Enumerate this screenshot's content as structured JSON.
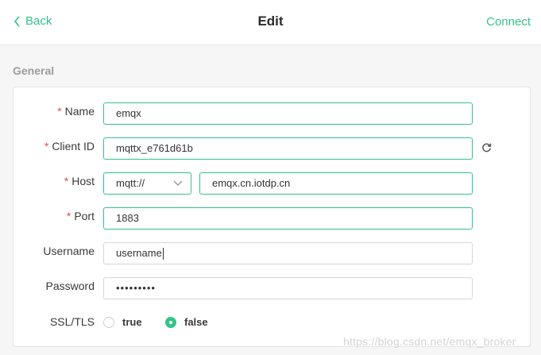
{
  "header": {
    "back_label": "Back",
    "title": "Edit",
    "connect_label": "Connect"
  },
  "section": {
    "title": "General"
  },
  "form": {
    "name": {
      "label": "Name",
      "required": "*",
      "value": "emqx"
    },
    "client_id": {
      "label": "Client ID",
      "required": "*",
      "value": "mqttx_e761d61b"
    },
    "host": {
      "label": "Host",
      "required": "*",
      "protocol": "mqtt://",
      "value": "emqx.cn.iotdp.cn"
    },
    "port": {
      "label": "Port",
      "required": "*",
      "value": "1883"
    },
    "username": {
      "label": "Username",
      "value": "username"
    },
    "password": {
      "label": "Password",
      "value": "•••••••••"
    },
    "ssl": {
      "label": "SSL/TLS",
      "options": [
        {
          "label": "true",
          "selected": false
        },
        {
          "label": "false",
          "selected": true
        }
      ]
    }
  },
  "icons": {
    "back": "chevron-left-icon",
    "refresh": "refresh-icon",
    "select": "chevron-down-icon"
  },
  "colors": {
    "accent": "#34c388",
    "required": "#e34a4a"
  },
  "watermark": "https://blog.csdn.net/emqx_broker"
}
